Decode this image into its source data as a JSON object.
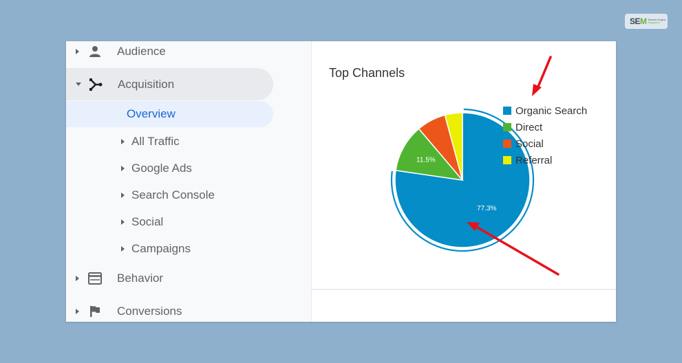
{
  "watermark": {
    "brand": "SEM",
    "line1": "Search Engine",
    "line2": "Magazine"
  },
  "sidebar": {
    "top_items": [
      {
        "label": "Audience",
        "icon": "person-icon",
        "expanded": false
      },
      {
        "label": "Acquisition",
        "icon": "acquisition-icon",
        "expanded": true
      },
      {
        "label": "Behavior",
        "icon": "behavior-icon",
        "expanded": false
      },
      {
        "label": "Conversions",
        "icon": "flag-icon",
        "expanded": false
      }
    ],
    "selected_item": "Overview",
    "sub_items": [
      {
        "label": "All Traffic"
      },
      {
        "label": "Google Ads"
      },
      {
        "label": "Search Console"
      },
      {
        "label": "Social"
      },
      {
        "label": "Campaigns"
      }
    ]
  },
  "card": {
    "title": "Top Channels"
  },
  "chart_data": {
    "type": "pie",
    "title": "Top Channels",
    "categories": [
      "Organic Search",
      "Direct",
      "Social",
      "Referral"
    ],
    "values": [
      77.3,
      11.5,
      7.0,
      4.2
    ],
    "unit": "%",
    "colors": [
      "#058dc7",
      "#50b432",
      "#ed561b",
      "#edef00"
    ],
    "data_labels": [
      "77.3%",
      "11.5%",
      "",
      ""
    ],
    "highlighted_slice": "Organic Search",
    "legend_position": "right"
  },
  "annotations": [
    {
      "type": "arrow",
      "color": "#e8101a",
      "points_to": "legend"
    },
    {
      "type": "arrow",
      "color": "#e8101a",
      "points_to": "Organic Search slice"
    }
  ]
}
